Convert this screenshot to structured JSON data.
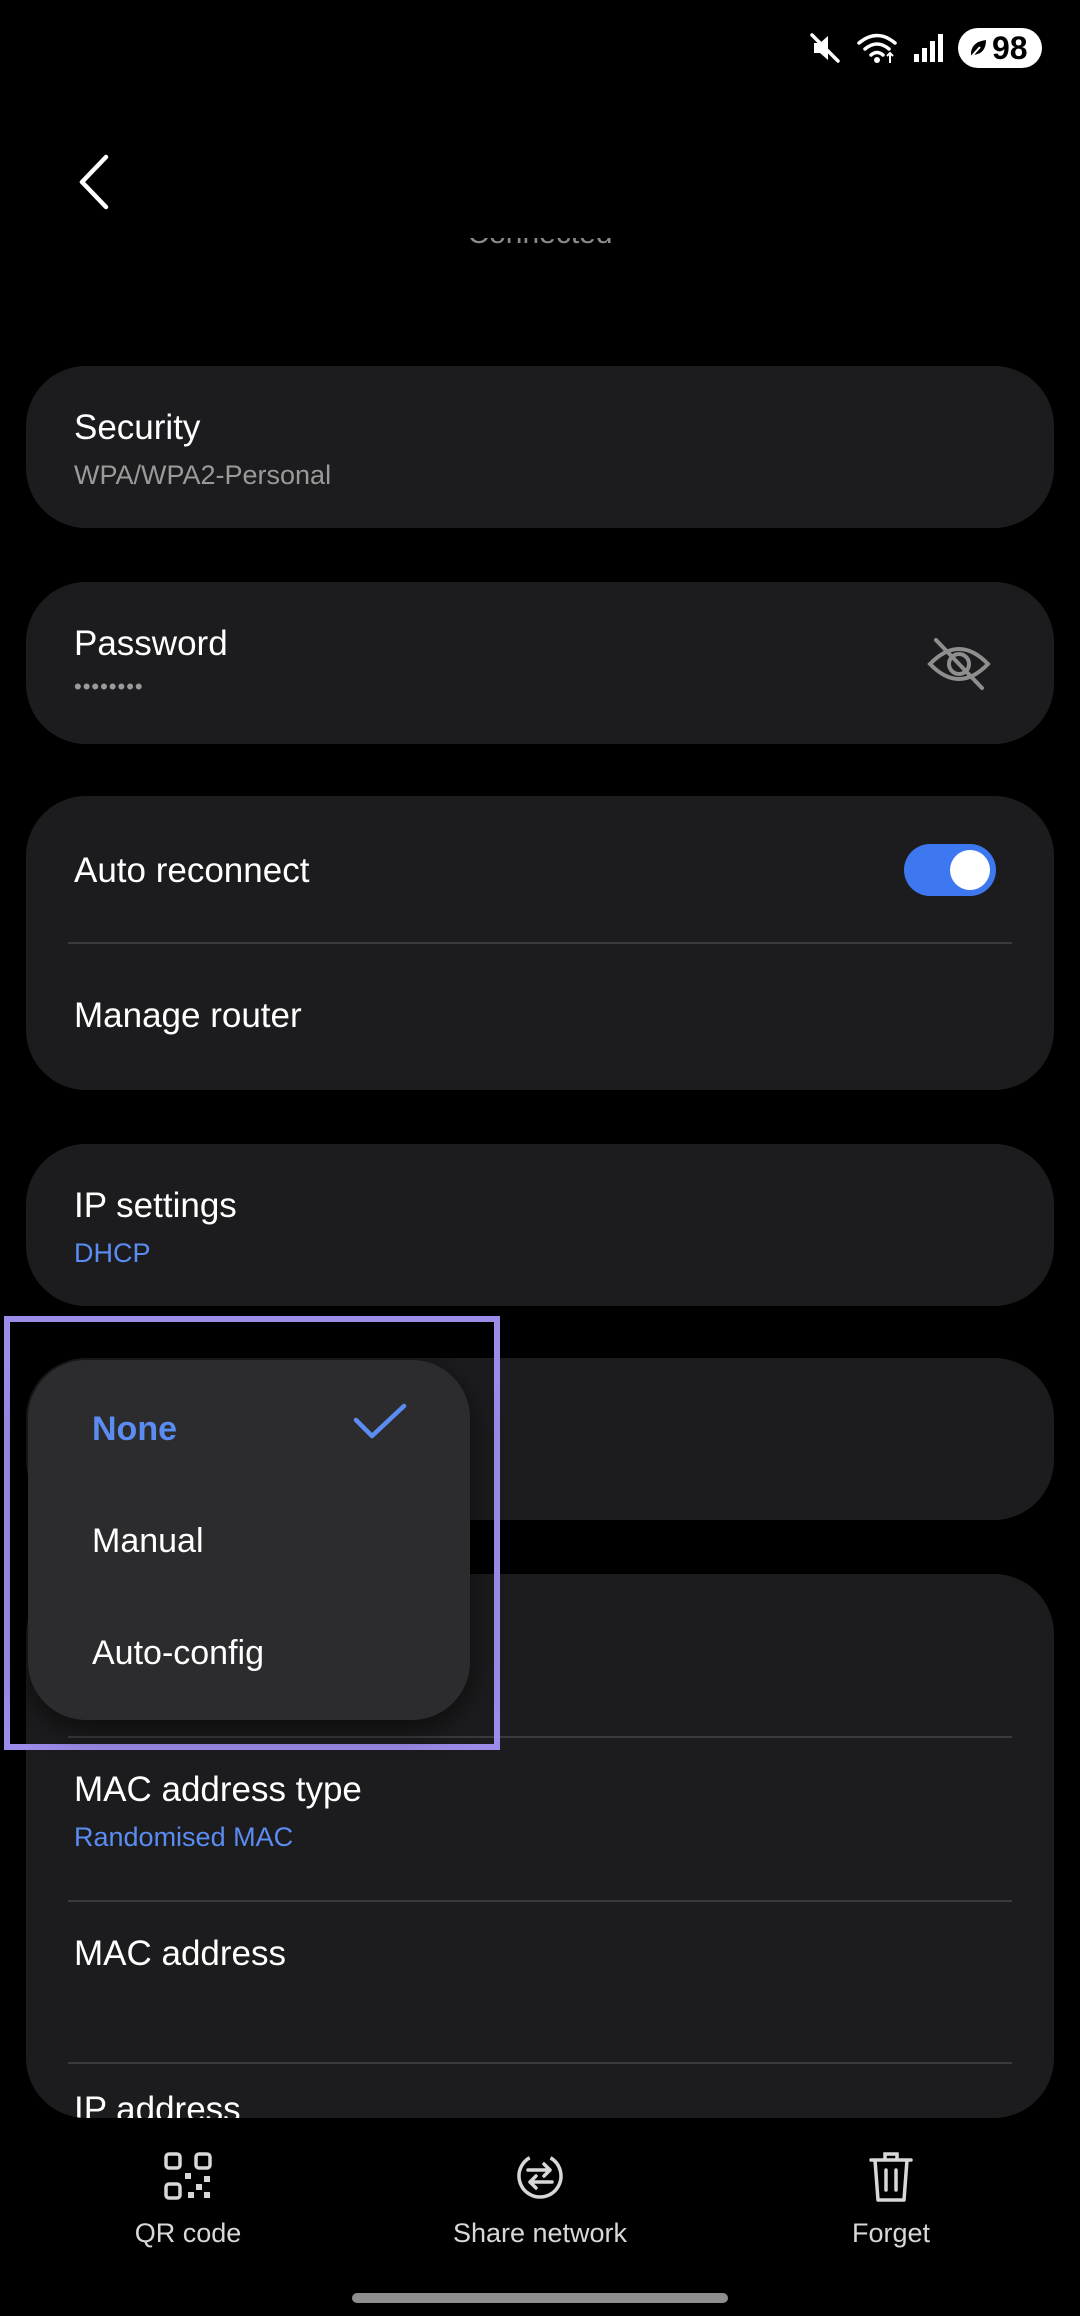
{
  "status_bar": {
    "icons": [
      "mute-icon",
      "wifi-icon",
      "signal-icon"
    ],
    "battery_level": "98"
  },
  "header": {
    "back_icon": "chevron-left-icon",
    "network_status": "Connected"
  },
  "security": {
    "title": "Security",
    "value": "WPA/WPA2-Personal"
  },
  "password": {
    "title": "Password",
    "value": "••••••••",
    "visibility_icon": "eye-off-icon"
  },
  "auto_reconnect": {
    "title": "Auto reconnect",
    "enabled": true
  },
  "manage_router": {
    "title": "Manage router"
  },
  "ip_settings": {
    "title": "IP settings",
    "value": "DHCP"
  },
  "proxy_menu": {
    "options": [
      "None",
      "Manual",
      "Auto-config"
    ],
    "selected": "None",
    "check_icon": "checkmark-icon"
  },
  "mac_type": {
    "title": "MAC address type",
    "value": "Randomised MAC"
  },
  "mac_address": {
    "title": "MAC address"
  },
  "ip_address": {
    "title": "IP address"
  },
  "bottom_actions": [
    {
      "label": "QR code",
      "icon": "qr-code-icon"
    },
    {
      "label": "Share network",
      "icon": "share-network-icon"
    },
    {
      "label": "Forget",
      "icon": "trash-icon"
    }
  ],
  "colors": {
    "accent": "#3e78f0",
    "link_blue": "#5a8cf2",
    "card_bg": "#1c1c1e",
    "menu_bg": "#2c2c2e",
    "highlight_border": "#9c8be8"
  }
}
